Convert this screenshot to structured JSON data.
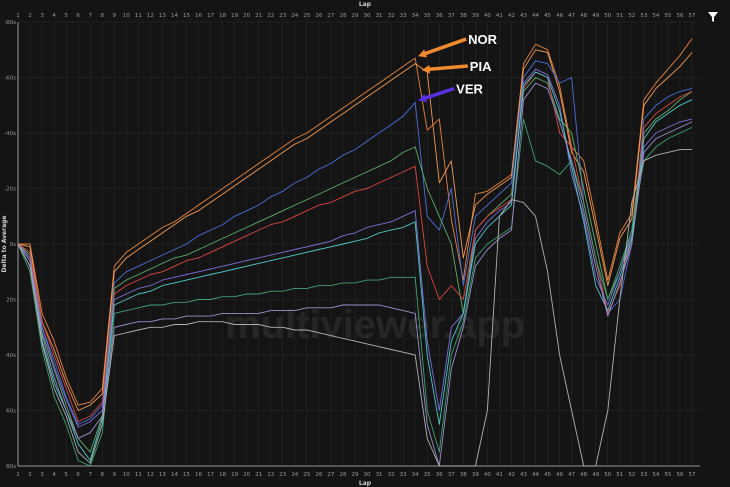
{
  "chart_data": {
    "type": "line",
    "title": "",
    "xlabel": "Lap",
    "ylabel": "Delta to Average",
    "xlim": [
      1,
      57
    ],
    "ylim": [
      -80,
      80
    ],
    "y_inverted": true,
    "grid": true,
    "x_ticks": [
      1,
      2,
      3,
      4,
      5,
      6,
      7,
      8,
      9,
      10,
      11,
      12,
      13,
      14,
      15,
      16,
      17,
      18,
      19,
      20,
      21,
      22,
      23,
      24,
      25,
      26,
      27,
      28,
      29,
      30,
      31,
      32,
      33,
      34,
      35,
      36,
      37,
      38,
      39,
      40,
      41,
      42,
      43,
      44,
      45,
      46,
      47,
      48,
      49,
      50,
      51,
      52,
      53,
      54,
      55,
      56,
      57
    ],
    "y_ticks": [
      {
        "value": -80,
        "label": "-80s"
      },
      {
        "value": -60,
        "label": "-60s"
      },
      {
        "value": -40,
        "label": "-40s"
      },
      {
        "value": -20,
        "label": "-20s"
      },
      {
        "value": 0,
        "label": "0s"
      },
      {
        "value": 20,
        "label": "20s"
      },
      {
        "value": 40,
        "label": "40s"
      },
      {
        "value": 60,
        "label": "60s"
      },
      {
        "value": 80,
        "label": "80s"
      }
    ],
    "series": [
      {
        "name": "NOR",
        "color": "#e8823a",
        "values": [
          0,
          0,
          25,
          35,
          48,
          58,
          57,
          52,
          8,
          3,
          0,
          -3,
          -6,
          -8,
          -11,
          -14,
          -17,
          -20,
          -23,
          -26,
          -29,
          -32,
          -35,
          -38,
          -40,
          -43,
          -46,
          -49,
          -52,
          -55,
          -58,
          -61,
          -64,
          -67,
          -41,
          -45,
          -9,
          13,
          -18,
          -19,
          -22,
          -25,
          -65,
          -72,
          -70,
          -57,
          -35,
          -30,
          -9,
          13,
          -4,
          -11,
          -52,
          -58,
          -63,
          -68,
          -74
        ]
      },
      {
        "name": "PIA",
        "color": "#f29a50",
        "values": [
          0,
          1,
          28,
          38,
          50,
          60,
          58,
          54,
          10,
          5,
          2,
          -1,
          -4,
          -7,
          -10,
          -12,
          -15,
          -18,
          -21,
          -24,
          -27,
          -30,
          -33,
          -36,
          -38,
          -41,
          -44,
          -47,
          -50,
          -53,
          -56,
          -59,
          -62,
          -65,
          -62,
          -22,
          -30,
          5,
          -14,
          -18,
          -21,
          -24,
          -63,
          -70,
          -69,
          -55,
          -33,
          -26,
          -6,
          15,
          -2,
          -9,
          -50,
          -56,
          -60,
          -64,
          -69
        ]
      },
      {
        "name": "VER",
        "color": "#4a6fd8",
        "values": [
          0,
          3,
          30,
          42,
          55,
          65,
          63,
          58,
          14,
          10,
          8,
          6,
          4,
          2,
          0,
          -3,
          -5,
          -7,
          -10,
          -12,
          -14,
          -17,
          -19,
          -22,
          -24,
          -27,
          -29,
          -32,
          -34,
          -37,
          -40,
          -43,
          -46,
          -51,
          -10,
          -5,
          -20,
          15,
          -10,
          -14,
          -18,
          -22,
          -60,
          -66,
          -65,
          -58,
          -60,
          -15,
          5,
          25,
          20,
          0,
          -45,
          -50,
          -53,
          -55,
          -56
        ]
      },
      {
        "name": "",
        "color": "#5fae6a",
        "values": [
          0,
          4,
          32,
          45,
          58,
          70,
          75,
          62,
          16,
          13,
          11,
          9,
          7,
          5,
          4,
          2,
          0,
          -2,
          -4,
          -6,
          -8,
          -10,
          -12,
          -14,
          -16,
          -18,
          -20,
          -22,
          -24,
          -26,
          -28,
          -30,
          -33,
          -35,
          -20,
          -10,
          0,
          25,
          -5,
          -10,
          -14,
          -18,
          -55,
          -60,
          -58,
          -45,
          -40,
          -20,
          0,
          20,
          10,
          -5,
          -40,
          -45,
          -48,
          -52,
          -55
        ]
      },
      {
        "name": "",
        "color": "#d9473f",
        "values": [
          0,
          3,
          28,
          40,
          52,
          64,
          62,
          57,
          18,
          15,
          13,
          11,
          10,
          8,
          6,
          5,
          3,
          1,
          -1,
          -3,
          -5,
          -7,
          -8,
          -10,
          -12,
          -14,
          -15,
          -17,
          -19,
          -20,
          -22,
          -24,
          -26,
          -28,
          8,
          20,
          15,
          20,
          -5,
          -10,
          -13,
          -16,
          -56,
          -62,
          -60,
          -40,
          -35,
          -15,
          5,
          25,
          15,
          -2,
          -42,
          -47,
          -50,
          -53,
          -55
        ]
      },
      {
        "name": "",
        "color": "#7a6fd8",
        "values": [
          0,
          5,
          30,
          44,
          56,
          66,
          64,
          60,
          20,
          18,
          16,
          15,
          13,
          12,
          11,
          10,
          9,
          8,
          7,
          6,
          5,
          4,
          3,
          2,
          1,
          0,
          -1,
          -3,
          -4,
          -6,
          -7,
          -8,
          -10,
          -12,
          35,
          60,
          30,
          25,
          -2,
          -8,
          -12,
          -15,
          -58,
          -63,
          -61,
          -50,
          -25,
          -10,
          12,
          22,
          10,
          -3,
          -35,
          -40,
          -42,
          -44,
          -45
        ]
      },
      {
        "name": "",
        "color": "#4fc8c8",
        "values": [
          0,
          8,
          35,
          50,
          60,
          72,
          78,
          63,
          22,
          20,
          18,
          17,
          15,
          14,
          13,
          12,
          11,
          10,
          9,
          8,
          7,
          6,
          5,
          4,
          3,
          2,
          1,
          0,
          -1,
          -2,
          -4,
          -5,
          -6,
          -8,
          40,
          65,
          35,
          25,
          0,
          -6,
          -10,
          -14,
          -57,
          -62,
          -60,
          -48,
          -28,
          -8,
          15,
          24,
          12,
          -2,
          -38,
          -44,
          -47,
          -50,
          -52
        ]
      },
      {
        "name": "",
        "color": "#3fa070",
        "values": [
          0,
          10,
          38,
          55,
          65,
          78,
          80,
          68,
          25,
          24,
          23,
          22,
          22,
          21,
          21,
          20,
          20,
          19,
          19,
          18,
          18,
          17,
          17,
          16,
          16,
          15,
          15,
          14,
          14,
          13,
          13,
          12,
          12,
          12,
          60,
          75,
          40,
          28,
          5,
          0,
          -3,
          -6,
          -45,
          -30,
          -28,
          -25,
          -30,
          -15,
          5,
          20,
          8,
          -5,
          -30,
          -35,
          -38,
          -40,
          -42
        ]
      },
      {
        "name": "",
        "color": "#9a8fd0",
        "values": [
          0,
          6,
          33,
          48,
          60,
          70,
          68,
          62,
          30,
          29,
          28,
          28,
          27,
          27,
          26,
          26,
          26,
          25,
          25,
          25,
          25,
          24,
          24,
          24,
          23,
          23,
          23,
          22,
          22,
          22,
          22,
          23,
          24,
          25,
          65,
          80,
          45,
          30,
          8,
          2,
          -2,
          -5,
          -52,
          -58,
          -56,
          -44,
          -30,
          -12,
          8,
          26,
          14,
          0,
          -33,
          -38,
          -40,
          -42,
          -44
        ]
      },
      {
        "name": "",
        "color": "#b0b0b0",
        "values": [
          0,
          8,
          36,
          52,
          62,
          75,
          79,
          65,
          33,
          32,
          31,
          30,
          30,
          29,
          29,
          28,
          28,
          28,
          29,
          29,
          29,
          30,
          30,
          31,
          31,
          32,
          33,
          34,
          35,
          36,
          37,
          38,
          39,
          40,
          70,
          85,
          85,
          85,
          85,
          60,
          -10,
          -16,
          -15,
          -10,
          10,
          40,
          60,
          80,
          85,
          60,
          20,
          -15,
          -30,
          -32,
          -33,
          -34,
          -34
        ]
      }
    ],
    "annotations": [
      {
        "label": "NOR",
        "color": "#f28a2e",
        "lap": 34,
        "value": -67
      },
      {
        "label": "PIA",
        "color": "#f28a2e",
        "lap": 34.3,
        "value": -62
      },
      {
        "label": "VER",
        "color": "#5a2fe0",
        "lap": 34,
        "value": -51
      }
    ]
  },
  "watermark": "multiviewer.app",
  "filter_icon": "filter-icon"
}
